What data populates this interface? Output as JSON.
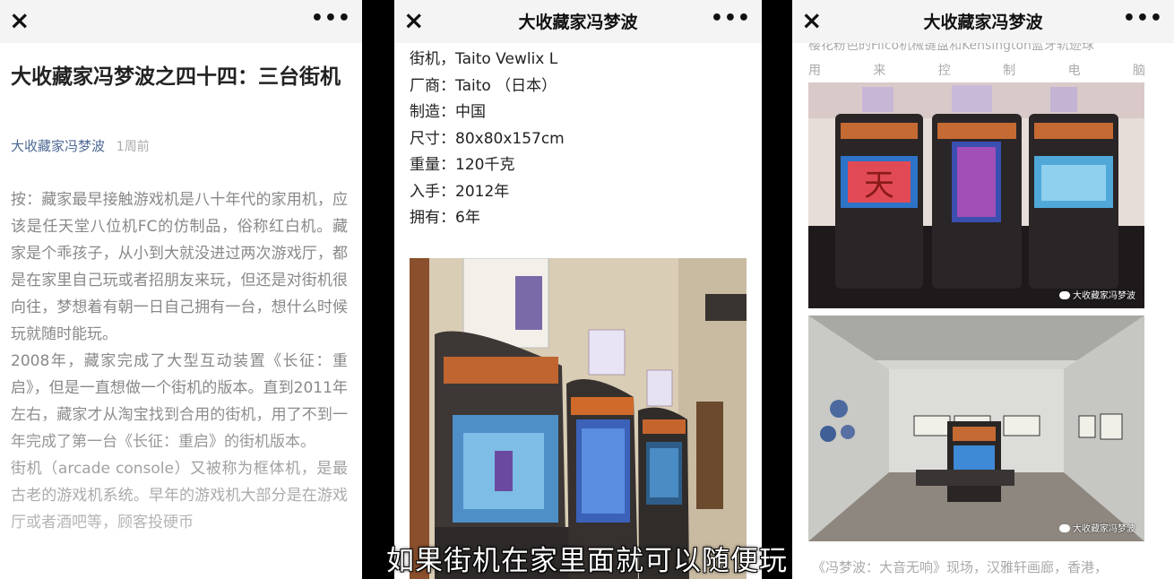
{
  "icons": {
    "close": "×",
    "more": "•••"
  },
  "left": {
    "article_title": "大收藏家冯梦波之四十四：三台街机",
    "author": "大收藏家冯梦波",
    "time": "1周前",
    "paragraphs": [
      "按：藏家最早接触游戏机是八十年代的家用机，应该是任天堂八位机FC的仿制品，俗称红白机。藏家是个乖孩子，从小到大就没进过两次游戏厅，都是在家里自己玩或者招朋友来玩，但还是对街机很向往，梦想着有朝一日自己拥有一台，想什么时候玩就随时能玩。",
      "2008年，藏家完成了大型互动装置《长征：重启》，但是一直想做一个街机的版本。直到2011年左右，藏家才从淘宝找到合用的街机，用了不到一年完成了第一台《长征：重启》的街机版本。",
      "街机（arcade console）又被称为框体机，是最古老的游戏机系统。早年的游戏机大部分是在游戏厅或者酒吧等，顾客投硬币"
    ]
  },
  "middle": {
    "nav_title": "大收藏家冯梦波",
    "specs": [
      "街机，Taito Vewlix L",
      "厂商：Taito （日本）",
      "制造：中国",
      "尺寸：80x80x157cm",
      "重量：120千克",
      "入手：2012年",
      "拥有：6年"
    ]
  },
  "right": {
    "nav_title": "大收藏家冯梦波",
    "cut_text": "樱花粉色的Filco机械键盘和Kensington蓝牙轨迹球",
    "spread_chars": [
      "用",
      "来",
      "控",
      "制",
      "电",
      "脑"
    ],
    "watermark": "大收藏家冯梦波",
    "bottom_caption": "《冯梦波：大音无响》现场，汉雅轩画廊，香港，"
  },
  "subtitle": "如果街机在家里面就可以随便玩"
}
